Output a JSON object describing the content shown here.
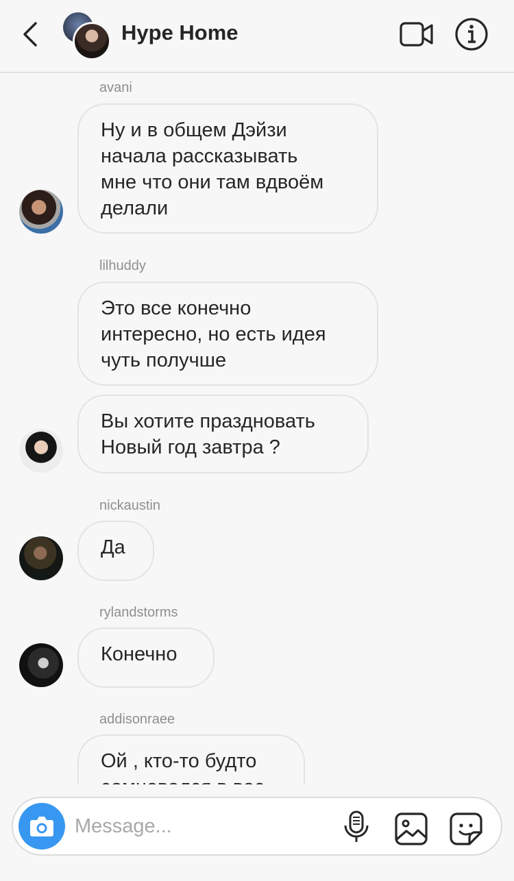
{
  "header": {
    "title": "Hype Home",
    "icons": {
      "back": "chevron-left-icon",
      "video": "video-camera-icon",
      "info": "info-icon"
    }
  },
  "messages": [
    {
      "sender": "avani",
      "text": "Ну и в общем Дэйзи\nначала рассказывать\nмне что они там вдвоём\nделали"
    },
    {
      "sender": "lilhuddy",
      "text": "Это все конечно\nинтересно, но есть идея\nчуть получше"
    },
    {
      "sender": "",
      "text": "Вы хотите праздновать\nНовый год завтра ?"
    },
    {
      "sender": "nickaustin",
      "text": "Да"
    },
    {
      "sender": "rylandstorms",
      "text": "Конечно"
    },
    {
      "sender": "addisonraee",
      "text": "Ой , кто-то будто\nсомневался в вас"
    }
  ],
  "composer": {
    "placeholder": "Message...",
    "icons": {
      "camera": "camera-icon",
      "mic": "microphone-icon",
      "gallery": "image-gallery-icon",
      "sticker": "sticker-icon"
    }
  },
  "colors": {
    "accent": "#3897f0",
    "bubble_border": "#e3e3e3",
    "background": "#f7f7f7",
    "muted_text": "#8e8e8e"
  }
}
